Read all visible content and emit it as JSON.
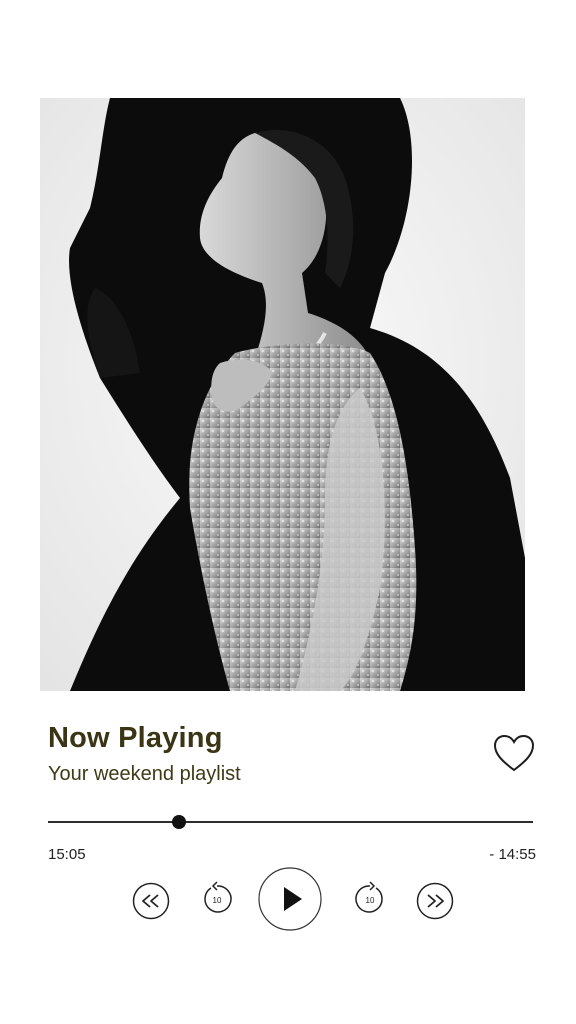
{
  "player": {
    "title": "Now Playing",
    "subtitle": "Your weekend playlist",
    "elapsed": "15:05",
    "remaining": "- 14:55",
    "progress": 0.27,
    "skip_seconds": "10",
    "liked": false
  },
  "icons": {
    "like": "heart-outline-icon",
    "rewind": "rewind-icon",
    "replay": "replay-10-icon",
    "play": "play-icon",
    "forward": "forward-10-icon",
    "fast_forward": "fast-forward-icon"
  },
  "colors": {
    "title": "#3a3514",
    "text": "#3f3a16",
    "track": "#2d2d2d",
    "background": "#ffffff"
  }
}
